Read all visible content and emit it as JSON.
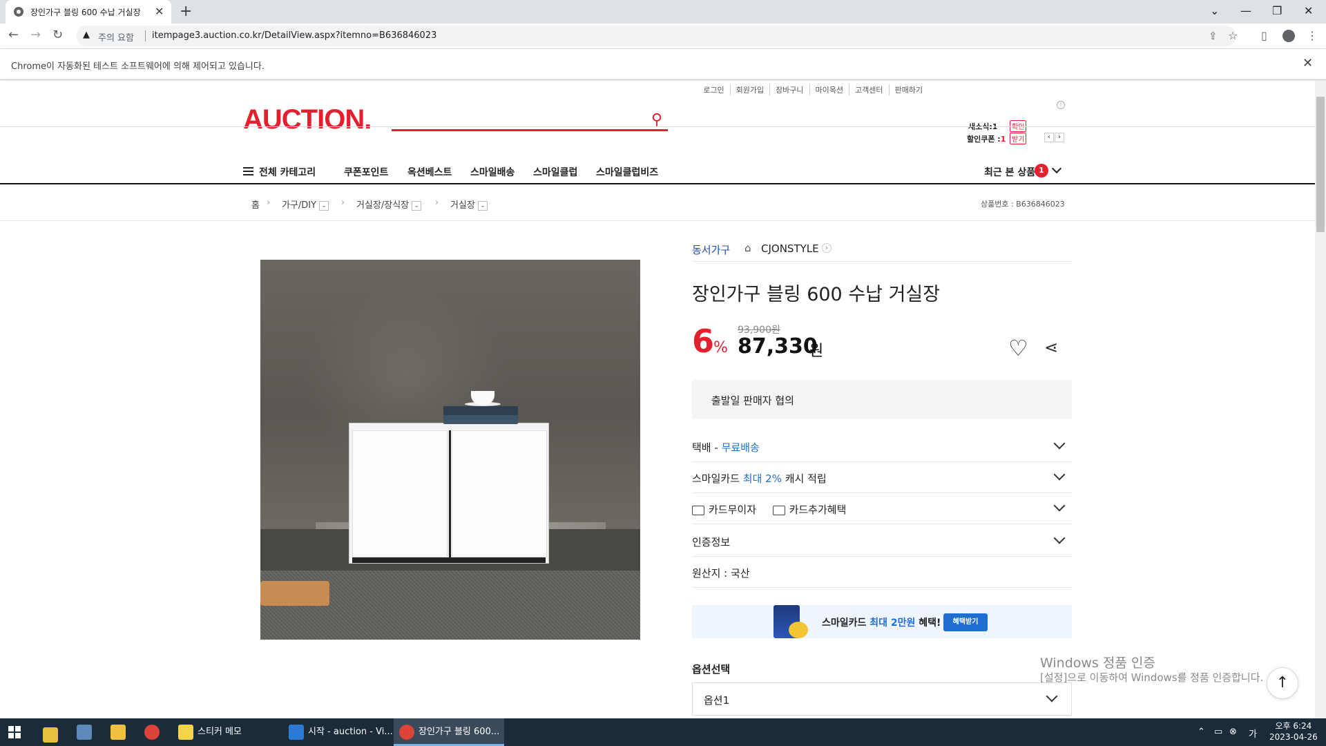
{
  "browser": {
    "tab_title": "장인가구 블링 600 수납 거실장",
    "new_tab": "+",
    "url_warning": "주의 요함",
    "url": "itempage3.auction.co.kr/DetailView.aspx?itemno=B636846023",
    "infobar": "Chrome이 자동화된 테스트 소프트웨어에 의해 제어되고 있습니다."
  },
  "header": {
    "util_links": [
      "로그인",
      "회원가입",
      "장바구니",
      "마이옥션",
      "고객센터",
      "판매하기"
    ],
    "logo": "AUCTION.",
    "news_label": "새소식:",
    "news_count": "1",
    "news_btn": "확인",
    "coupon_label": "할인쿠폰 :",
    "coupon_count": "1",
    "coupon_btn": "받기"
  },
  "nav": {
    "all_categories": "전체 카테고리",
    "items": [
      "쿠폰포인트",
      "옥션베스트",
      "스마일배송",
      "스마일클럽",
      "스마일클럽비즈"
    ],
    "recent": "최근 본 상품",
    "recent_count": "1"
  },
  "breadcrumb": {
    "home": "홈",
    "level1": "가구/DIY",
    "level2": "거실장/장식장",
    "level3": "거실장",
    "product_no": "상품번호 : B636846023"
  },
  "product": {
    "brand": "동서가구",
    "store": "CJONSTYLE",
    "title": "장인가구 블링 600 수납 거실장",
    "discount": "6",
    "discount_unit": "%",
    "original_price": "93,900원",
    "sale_price": "87,330",
    "sale_unit": "원",
    "ship_date": "출발일 판매자 협의",
    "delivery_label": "택배 - ",
    "delivery_value": "무료배송",
    "smilecard_label": "스마일카드 ",
    "smilecard_value": "최대 2%",
    "smilecard_suffix": " 캐시 적립",
    "card_interest": "카드무이자",
    "card_benefit": "카드추가혜택",
    "certification": "인증정보",
    "origin": "원산지 : 국산",
    "promo_prefix": "스마일카드 ",
    "promo_highlight": "최대 2만원",
    "promo_suffix": " 혜택!",
    "promo_button": "혜택받기",
    "option_label": "옵션선택",
    "option_value": "옵션1"
  },
  "watermark": {
    "line1": "Windows 정품 인증",
    "line2": "[설정]으로 이동하여 Windows를 정품 인증합니다."
  },
  "taskbar": {
    "apps": [
      "스티커 메모",
      "시작 - auction - Vi...",
      "장인가구 블링 600..."
    ],
    "time": "오후 6:24",
    "date": "2023-04-26"
  },
  "colors": {
    "brand_red": "#e5202e",
    "link_blue": "#1f6fd1"
  }
}
